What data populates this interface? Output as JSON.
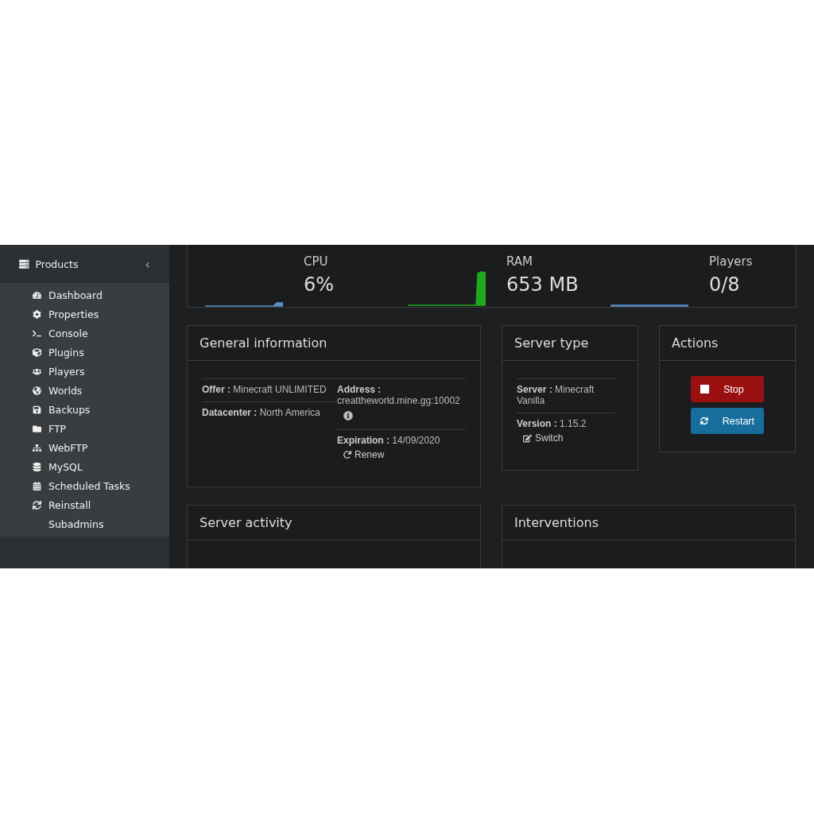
{
  "sidebar": {
    "header": "Products",
    "collapse": "‹",
    "items": [
      {
        "label": "Dashboard"
      },
      {
        "label": "Properties"
      },
      {
        "label": "Console"
      },
      {
        "label": "Plugins"
      },
      {
        "label": "Players"
      },
      {
        "label": "Worlds"
      },
      {
        "label": "Backups"
      },
      {
        "label": "FTP"
      },
      {
        "label": "WebFTP"
      },
      {
        "label": "MySQL"
      },
      {
        "label": "Scheduled Tasks"
      },
      {
        "label": "Reinstall"
      },
      {
        "label": "Subadmins"
      }
    ]
  },
  "stats": [
    {
      "label": "CPU",
      "value": "6%",
      "color": "#5b8fc9"
    },
    {
      "label": "RAM",
      "value": "653 MB",
      "color": "#1fa81f"
    },
    {
      "label": "Players",
      "value": "0/8",
      "color": "#5b8fc9"
    }
  ],
  "general_information": {
    "title": "General information",
    "left": [
      "**Offer :** Minecraft UNLIMITED",
      "**Datacenter :** North America"
    ],
    "address": "**Address :** creattheworld.mine.gg:10002",
    "expiration": "**Expiration :** 14/09/2020",
    "renew": "Renew"
  },
  "server_type": {
    "title": "Server type",
    "server": "**Server :** Minecraft Vanilla",
    "version": "**Version :** 1.15.2",
    "switch": "Switch"
  },
  "actions": {
    "title": "Actions",
    "buttons": [
      {
        "label": "Stop",
        "kind": "stop"
      },
      {
        "label": "Restart",
        "kind": "restart"
      }
    ]
  },
  "bottom_panels": [
    {
      "title": "Server activity"
    },
    {
      "title": "Interventions"
    }
  ]
}
